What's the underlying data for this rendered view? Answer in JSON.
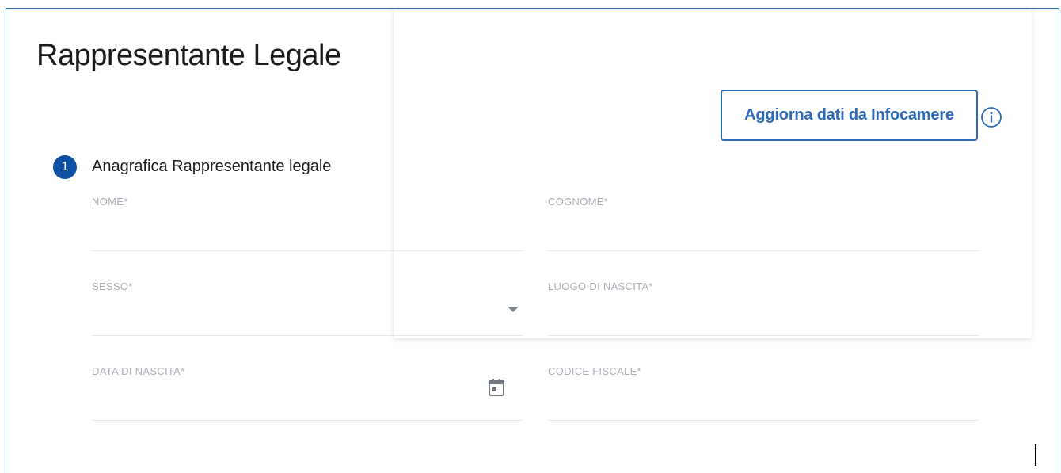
{
  "page": {
    "title": "Rappresentante Legale"
  },
  "actions": {
    "infocamere_label": "Aggiorna dati da Infocamere"
  },
  "step": {
    "number": "1",
    "title": "Anagrafica Rappresentante legale"
  },
  "fields": {
    "nome": {
      "label": "NOME*",
      "value": ""
    },
    "cognome": {
      "label": "COGNOME*",
      "value": ""
    },
    "sesso": {
      "label": "SESSO*",
      "value": ""
    },
    "luogo_nascita": {
      "label": "LUOGO DI NASCITA*",
      "value": ""
    },
    "data_nascita": {
      "label": "DATA DI NASCITA*",
      "value": ""
    },
    "codice_fiscale": {
      "label": "CODICE FISCALE*",
      "value": ""
    }
  },
  "icons": {
    "info": "info-icon",
    "calendar": "calendar-icon",
    "dropdown": "chevron-down-icon"
  },
  "colors": {
    "accent": "#2f6bb5",
    "badge": "#0d4fa3",
    "label": "#a8aeb5",
    "divider": "#e4e6e9"
  }
}
